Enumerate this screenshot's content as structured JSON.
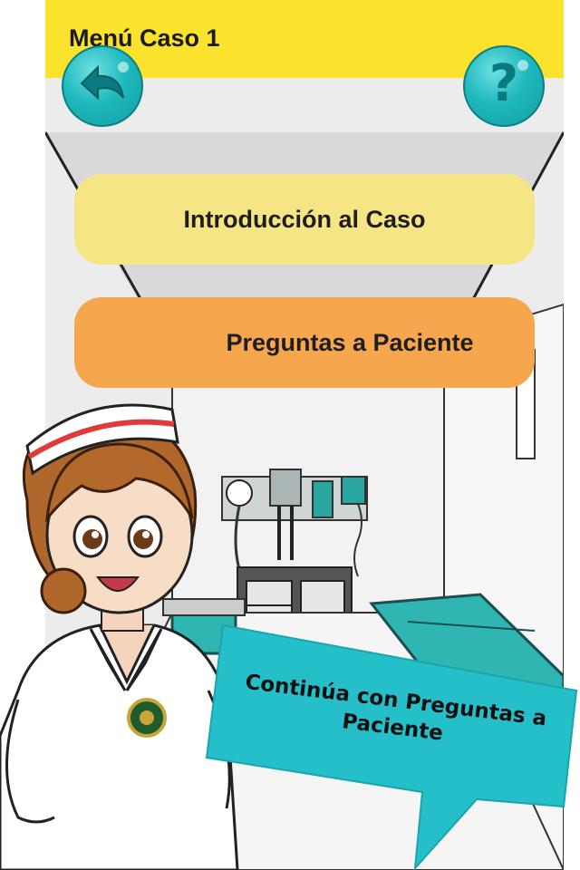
{
  "header": {
    "title": "Menú Caso 1"
  },
  "buttons": {
    "back_icon": "undo-arrow-icon",
    "help_icon": "question-mark-icon",
    "help_glyph": "?"
  },
  "menu": {
    "items": [
      {
        "label": "Introducción al Caso"
      },
      {
        "label": "Preguntas a Paciente"
      }
    ]
  },
  "speech_bubble": {
    "text": "Continúa con Preguntas a Paciente"
  },
  "colors": {
    "header": "#fbe22d",
    "intro_button": "#f6e585",
    "questions_button": "#f6a64c",
    "accent_teal": "#1fb9bd",
    "bubble": "#25bfc9"
  }
}
